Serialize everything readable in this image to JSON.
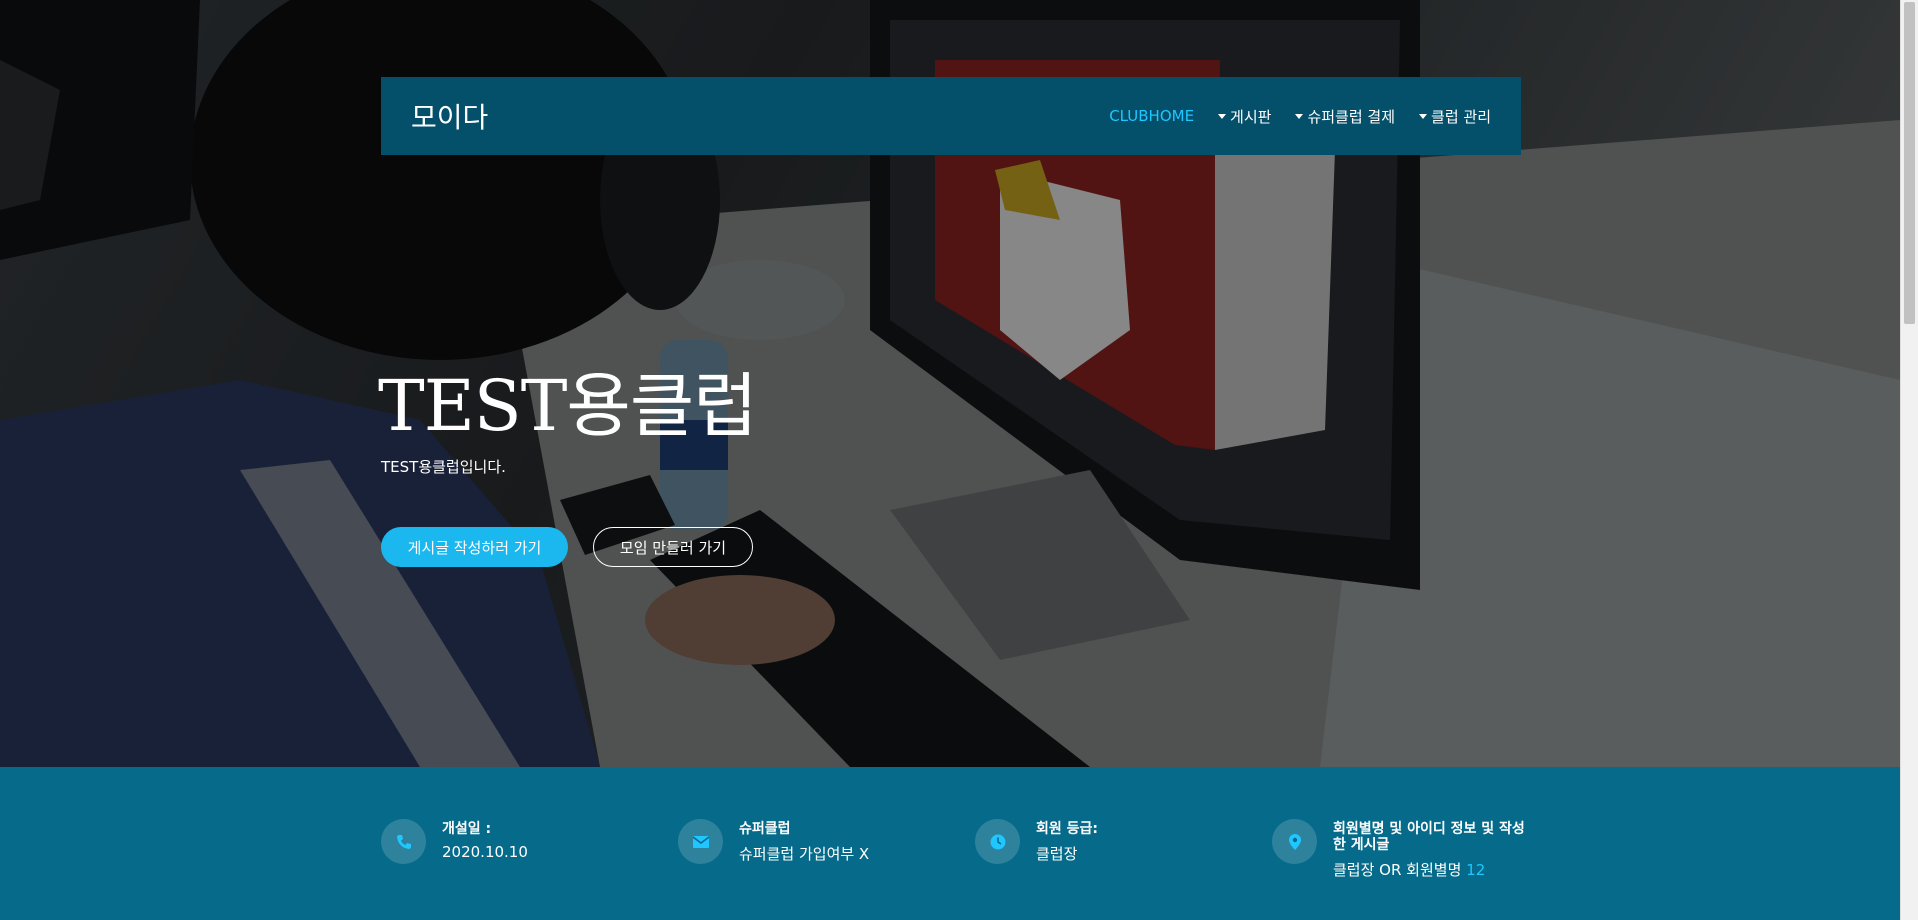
{
  "nav": {
    "brand": "모이다",
    "items": [
      {
        "label": "CLUBHOME",
        "active": true,
        "dropdown": false
      },
      {
        "label": "게시판",
        "active": false,
        "dropdown": true
      },
      {
        "label": "슈퍼클럽 결제",
        "active": false,
        "dropdown": true
      },
      {
        "label": "클럽 관리",
        "active": false,
        "dropdown": true
      }
    ]
  },
  "hero": {
    "title": "TEST용클럽",
    "subtitle": "TEST용클럽입니다.",
    "primary_button": "게시글 작성하러 가기",
    "secondary_button": "모임 만들러 가기"
  },
  "info": [
    {
      "icon": "phone-icon",
      "label": "개설일 :",
      "value": "2020.10.10"
    },
    {
      "icon": "envelope-icon",
      "label": "슈퍼클럽",
      "value": "슈퍼클럽 가입여부 X"
    },
    {
      "icon": "clock-icon",
      "label": "회원 등급:",
      "value": "클럽장"
    },
    {
      "icon": "map-marker-icon",
      "label": "회원별명 및 아이디 정보 및 작성한 게시글",
      "value_prefix": "클럽장 OR 회원별명",
      "value_count": "12"
    }
  ],
  "colors": {
    "navbar": "#04506b",
    "accent": "#1fc6ff",
    "button": "#1bb7ef",
    "info_band": "#066b8a"
  }
}
